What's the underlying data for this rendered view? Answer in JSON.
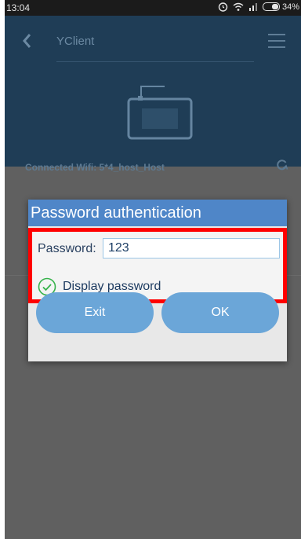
{
  "status_bar": {
    "time": "13:04",
    "battery": "34%"
  },
  "header": {
    "title": "YClient"
  },
  "device": {
    "wifi_label": "Connected Wifi: 5*4_host_Host"
  },
  "dialog": {
    "title": "Password authentication",
    "password_label": "Password:",
    "password_value": "123",
    "display_password_label": "Display password",
    "display_password_checked": true,
    "exit_label": "Exit",
    "ok_label": "OK"
  },
  "colors": {
    "header_bg": "#1f3d56",
    "dialog_title_bg": "#4f86c8",
    "highlight_border": "#ff0000",
    "button_bg": "#6ba6d8",
    "check_green": "#35b24a"
  }
}
